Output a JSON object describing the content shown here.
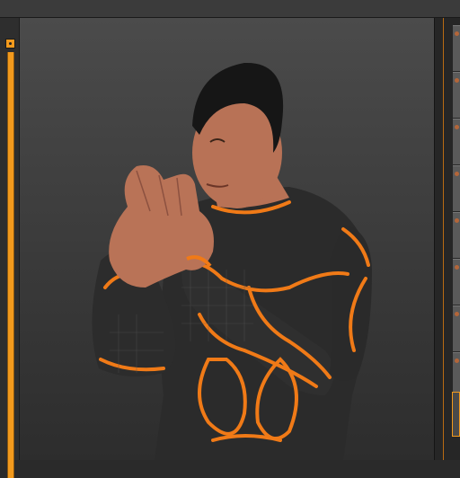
{
  "app": {
    "title": ""
  },
  "colors": {
    "accent": "#f29a1d",
    "viewport_bg_top": "#4b4b4b",
    "viewport_bg_bottom": "#2d2d2d",
    "suit_base": "#2b2b2b",
    "suit_trim": "#f07a17",
    "skin": "#b87256",
    "hair": "#1a1a1a"
  },
  "icons": {
    "left_toggle": "panel-toggle-icon",
    "figure": "3d-figure-icon"
  },
  "right_strip": {
    "thumbnails": [
      "",
      "",
      "",
      "",
      "",
      "",
      "",
      ""
    ],
    "selected_index": 7
  }
}
